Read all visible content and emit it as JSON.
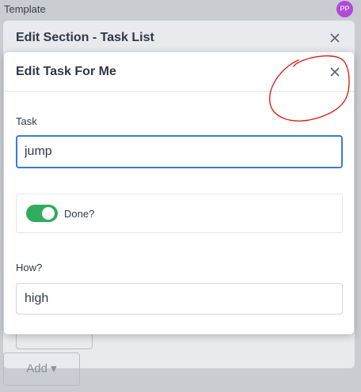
{
  "app": {
    "template_label": "Template",
    "avatar_initials": "PP",
    "avatar_color": "#b04ad6"
  },
  "outer_modal": {
    "title": "Edit Section - Task List",
    "close_icon": "close-icon",
    "background_buttons": [
      "Add",
      "Add ▾"
    ]
  },
  "inner_modal": {
    "title": "Edit Task For Me",
    "close_icon": "close-icon",
    "task": {
      "label": "Task",
      "value": "jump"
    },
    "done": {
      "label": "Done?",
      "checked": true,
      "color": "#2eae5c"
    },
    "how": {
      "label": "How?",
      "value": "high"
    }
  },
  "annotation": {
    "type": "red-circle",
    "color": "#e0201b"
  },
  "theme": {
    "accent": "#3b7bd4"
  }
}
